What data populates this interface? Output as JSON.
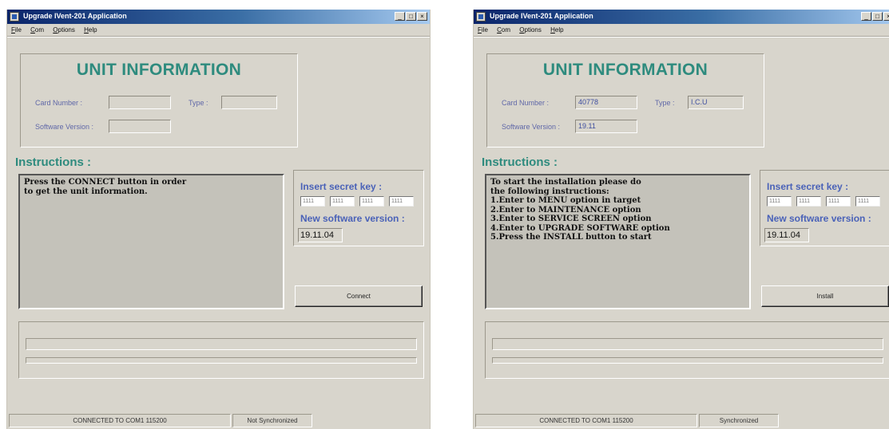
{
  "windows": [
    {
      "title": "Upgrade IVent-201 Application",
      "menu": [
        "File",
        "Com",
        "Options",
        "Help"
      ],
      "unit_info": {
        "heading": "UNIT INFORMATION",
        "card_number_label": "Card Number :",
        "card_number_value": "",
        "type_label": "Type :",
        "type_value": "",
        "software_version_label": "Software Version :",
        "software_version_value": ""
      },
      "instructions": {
        "heading": "Instructions :",
        "lines": [
          "Press the CONNECT button in order",
          "to get the unit information."
        ]
      },
      "secret": {
        "label": "Insert secret key :",
        "keys": [
          "1111",
          "1111",
          "1111",
          "1111"
        ],
        "new_version_label": "New software version :",
        "new_version_value": "19.11.04"
      },
      "action_button": "Connect",
      "status": {
        "connection": "CONNECTED TO COM1  115200",
        "sync": "Not Synchronized"
      }
    },
    {
      "title": "Upgrade IVent-201 Application",
      "menu": [
        "File",
        "Com",
        "Options",
        "Help"
      ],
      "unit_info": {
        "heading": "UNIT INFORMATION",
        "card_number_label": "Card Number :",
        "card_number_value": "40778",
        "type_label": "Type :",
        "type_value": "I.C.U",
        "software_version_label": "Software Version :",
        "software_version_value": "19.11"
      },
      "instructions": {
        "heading": "Instructions :",
        "lines": [
          "To start the installation please do",
          "the following instructions:",
          "1.Enter to MENU option in target",
          "2.Enter to MAINTENANCE option",
          "3.Enter to SERVICE SCREEN option",
          "4.Enter to UPGRADE SOFTWARE option",
          "5.Press the INSTALL button to start"
        ]
      },
      "secret": {
        "label": "Insert secret key :",
        "keys": [
          "1111",
          "1111",
          "1111",
          "1111"
        ],
        "new_version_label": "New software version :",
        "new_version_value": "19.11.04"
      },
      "action_button": "Install",
      "status": {
        "connection": "CONNECTED TO COM1  115200",
        "sync": "Synchronized"
      }
    }
  ]
}
